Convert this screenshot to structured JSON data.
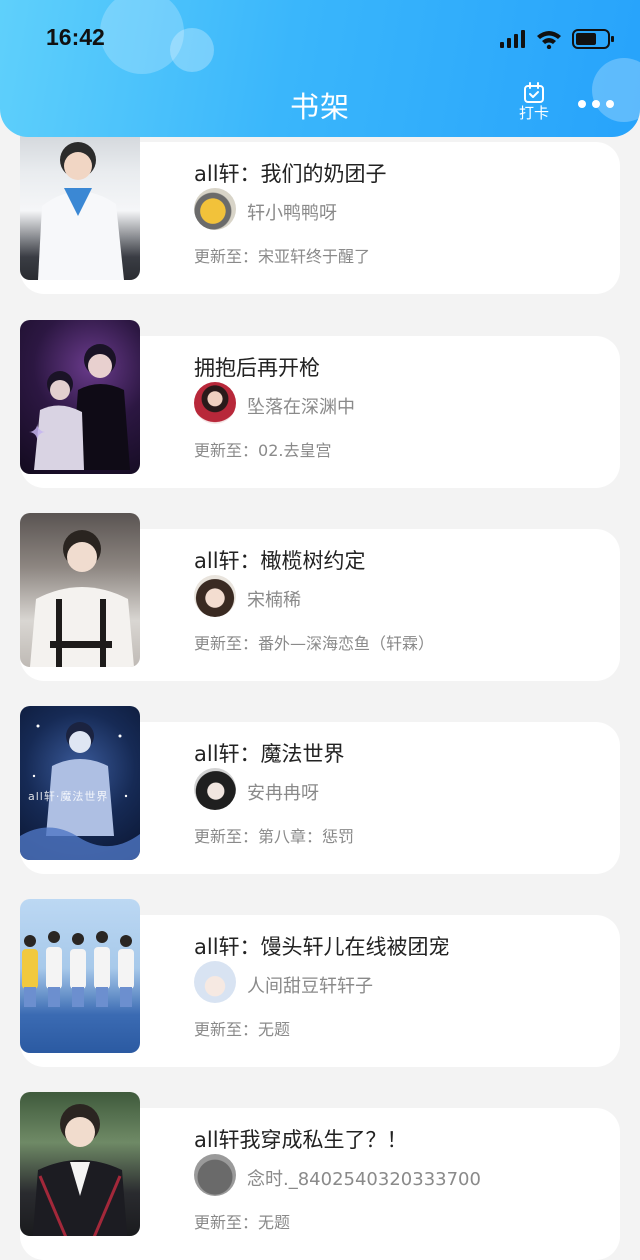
{
  "status_bar": {
    "time": "16:42"
  },
  "header": {
    "title": "书架",
    "checkin_label": "打卡"
  },
  "update_prefix": "更新至：",
  "books": [
    {
      "title": "all轩：我们的奶团子",
      "author": "轩小鸭鸭呀",
      "latest": "宋亚轩终于醒了"
    },
    {
      "title": "拥抱后再开枪",
      "author": "坠落在深渊中",
      "latest": "02.去皇宫"
    },
    {
      "title": "all轩：橄榄树约定",
      "author": "宋楠稀",
      "latest": "番外—深海恋鱼（轩霖）"
    },
    {
      "title": "all轩：魔法世界",
      "author": "安冉冉呀",
      "latest": "第八章：惩罚",
      "cover_text": "all轩·魔法世界"
    },
    {
      "title": "all轩：馒头轩儿在线被团宠",
      "author": "人间甜豆轩轩子",
      "latest": "无题"
    },
    {
      "title": "all轩我穿成私生了？！",
      "author": "念时._8402540320333700",
      "latest": "无题"
    }
  ],
  "colors": {
    "header_gradient_start": "#5fd0fb",
    "header_gradient_end": "#27a3fb",
    "page_bg": "#f3f3f3",
    "card_bg": "#ffffff",
    "title_text": "#222222",
    "meta_text": "#8a8a8a"
  },
  "icons": [
    "signal-icon",
    "wifi-icon",
    "battery-icon",
    "calendar-check-icon",
    "more-icon"
  ]
}
